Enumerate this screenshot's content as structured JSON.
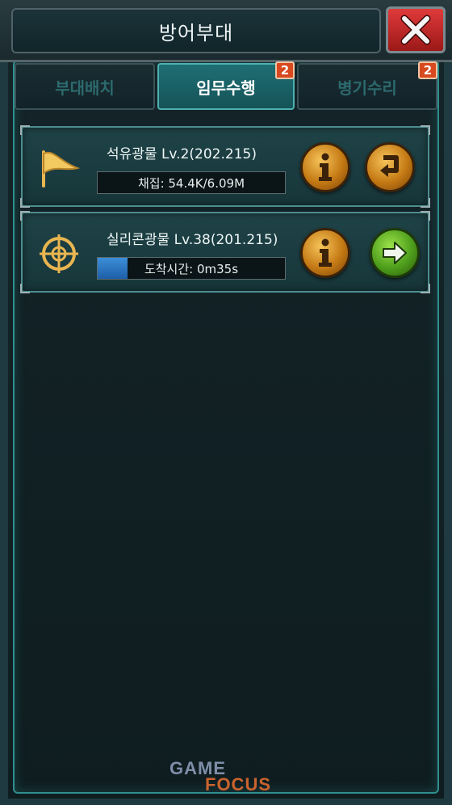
{
  "header": {
    "title": "방어부대"
  },
  "tabs": [
    {
      "label": "부대배치",
      "active": false,
      "badge": ""
    },
    {
      "label": "임무수행",
      "active": true,
      "badge": "2"
    },
    {
      "label": "병기수리",
      "active": false,
      "badge": "2"
    }
  ],
  "missions": [
    {
      "icon": "flag-icon",
      "title": "석유광물 Lv.2(202.215)",
      "status": "채집: 54.4K/6.09M",
      "progress": 0,
      "info_icon": "info-icon",
      "action_icon": "return-arrow-icon",
      "action_color": "#c47914"
    },
    {
      "icon": "crosshair-icon",
      "title": "실리콘광물 Lv.38(201.215)",
      "status": "도착시간: 0m35s",
      "progress": 0.16,
      "info_icon": "info-icon",
      "action_icon": "arrow-right-icon",
      "action_color": "#4e9e1c"
    }
  ],
  "watermark": {
    "line1": "GAME",
    "line2": "FOCUS"
  },
  "colors": {
    "accent": "#2f8f8f",
    "close": "#c62828",
    "progress": "#2a72c0"
  }
}
